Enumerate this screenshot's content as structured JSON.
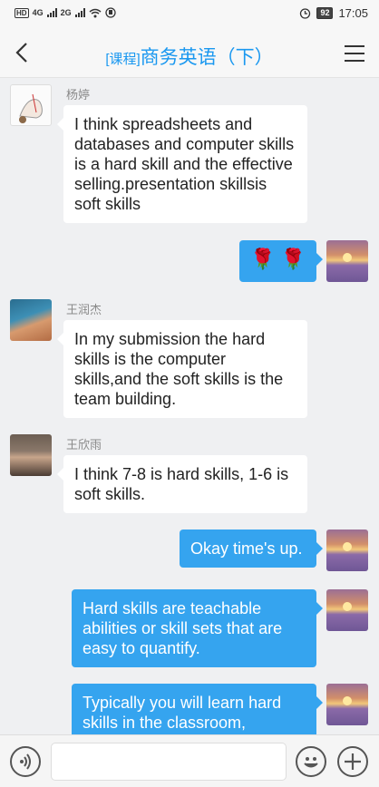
{
  "status": {
    "network": "4G",
    "network2": "2G",
    "battery": "92",
    "time": "17:05"
  },
  "header": {
    "tag": "[课程]",
    "title": "商务英语（下）"
  },
  "messages": [
    {
      "sender": "杨婷",
      "text": "I think spreadsheets and databases and computer skills is a hard skill and the effective selling.presentation skillsis soft skills"
    },
    {
      "sender": "",
      "text": "🌹 🌹"
    },
    {
      "sender": "王润杰",
      "text": "In my submission the hard skills is the computer skills,and the soft skills is the team building."
    },
    {
      "sender": "王欣雨",
      "text": "I think 7-8 is hard skills, 1-6 is soft skills."
    },
    {
      "sender": "",
      "text": "Okay time's up."
    },
    {
      "sender": "",
      "text": "Hard skills are teachable abilities or skill sets that are easy to quantify."
    },
    {
      "sender": "",
      "text": "Typically you will learn hard skills in the classroom,"
    }
  ],
  "icons": {
    "back": "back-arrow-icon",
    "menu": "menu-icon",
    "voice": "voice-icon",
    "emoji": "emoji-icon",
    "plus": "plus-icon"
  }
}
